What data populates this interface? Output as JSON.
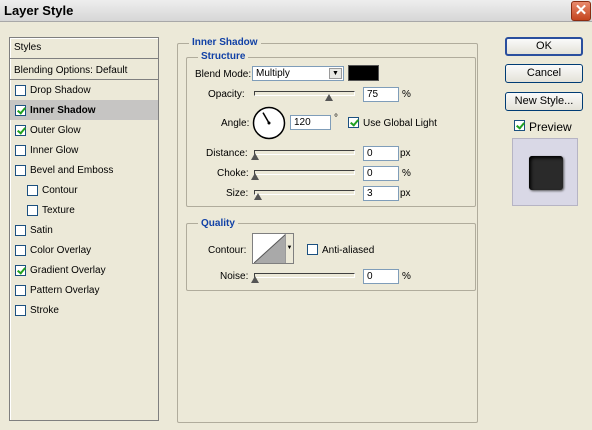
{
  "window": {
    "title": "Layer Style",
    "close_label": "✕"
  },
  "styles_list": {
    "header": "Styles",
    "blending": "Blending Options: Default",
    "items": [
      {
        "label": "Drop Shadow",
        "checked": false,
        "selected": false,
        "indent": false
      },
      {
        "label": "Inner Shadow",
        "checked": true,
        "selected": true,
        "indent": false
      },
      {
        "label": "Outer Glow",
        "checked": true,
        "selected": false,
        "indent": false
      },
      {
        "label": "Inner Glow",
        "checked": false,
        "selected": false,
        "indent": false
      },
      {
        "label": "Bevel and Emboss",
        "checked": false,
        "selected": false,
        "indent": false
      },
      {
        "label": "Contour",
        "checked": false,
        "selected": false,
        "indent": true
      },
      {
        "label": "Texture",
        "checked": false,
        "selected": false,
        "indent": true
      },
      {
        "label": "Satin",
        "checked": false,
        "selected": false,
        "indent": false
      },
      {
        "label": "Color Overlay",
        "checked": false,
        "selected": false,
        "indent": false
      },
      {
        "label": "Gradient Overlay",
        "checked": true,
        "selected": false,
        "indent": false
      },
      {
        "label": "Pattern Overlay",
        "checked": false,
        "selected": false,
        "indent": false
      },
      {
        "label": "Stroke",
        "checked": false,
        "selected": false,
        "indent": false
      }
    ]
  },
  "inner_shadow": {
    "title": "Inner Shadow",
    "structure": {
      "title": "Structure",
      "blend_mode_label": "Blend Mode:",
      "blend_mode_value": "Multiply",
      "blend_color": "#000000",
      "opacity_label": "Opacity:",
      "opacity_value": "75",
      "opacity_unit": "%",
      "angle_label": "Angle:",
      "angle_value": "120",
      "angle_unit": "°",
      "use_global_light_label": "Use Global Light",
      "use_global_light_checked": true,
      "distance_label": "Distance:",
      "distance_value": "0",
      "distance_unit": "px",
      "choke_label": "Choke:",
      "choke_value": "0",
      "choke_unit": "%",
      "size_label": "Size:",
      "size_value": "3",
      "size_unit": "px"
    },
    "quality": {
      "title": "Quality",
      "contour_label": "Contour:",
      "anti_aliased_label": "Anti-aliased",
      "anti_aliased_checked": false,
      "noise_label": "Noise:",
      "noise_value": "0",
      "noise_unit": "%"
    }
  },
  "buttons": {
    "ok": "OK",
    "cancel": "Cancel",
    "new_style": "New Style...",
    "preview_label": "Preview",
    "preview_checked": true
  },
  "sliders": {
    "opacity_fraction": 0.75,
    "distance_fraction": 0.0,
    "choke_fraction": 0.0,
    "size_fraction": 0.03,
    "noise_fraction": 0.0
  }
}
